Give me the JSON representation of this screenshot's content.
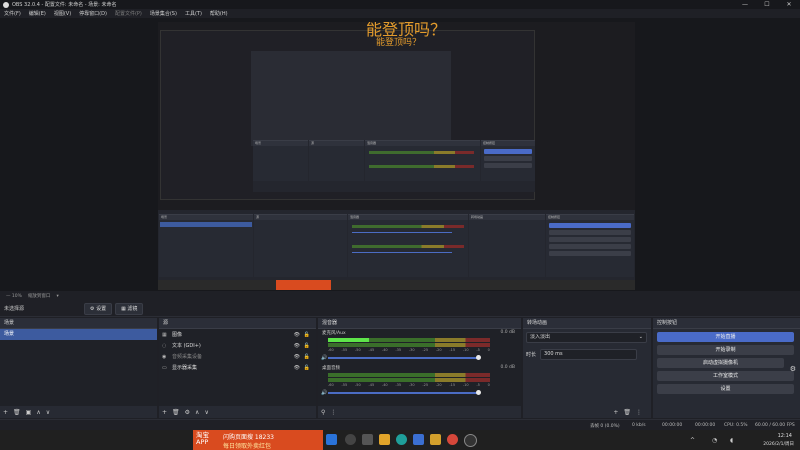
{
  "window": {
    "title": "OBS 32.0.4 - 配置文件: 未命名 - 场景: 未命名",
    "controls": [
      "—",
      "☐",
      "✕"
    ]
  },
  "menu": [
    "文件(F)",
    "编辑(E)",
    "视图(V)",
    "停靠窗口(D)",
    "配置文件(P)",
    "场景集合(S)",
    "工具(T)",
    "帮助(H)"
  ],
  "preview": {
    "overlay_text_1": "能登顶吗？",
    "overlay_text_2": "能登顶吗？",
    "zoom_label": "—  10%",
    "zoom_mode": "缩放到窗口",
    "zoom_arrow": "▾"
  },
  "scene_toolbar": {
    "label": "未选择源",
    "settings_label": "⚙ 设置",
    "filters_label": "▦ 滤镜"
  },
  "scenes": {
    "title": "场景",
    "items": [
      "场景"
    ],
    "footer_icons": [
      "+",
      "🗑",
      "▣",
      "∧",
      "∨"
    ]
  },
  "sources": {
    "title": "源",
    "items": [
      {
        "icon": "▦",
        "label": "图像",
        "visible": true,
        "locked": false
      },
      {
        "icon": "◌",
        "label": "文本 (GDI+)",
        "visible": true,
        "locked": false
      },
      {
        "icon": "◉",
        "label": "音频采集设备",
        "visible": true,
        "locked": false,
        "disabled": true
      },
      {
        "icon": "▭",
        "label": "显示器采集",
        "visible": true,
        "locked": false
      }
    ],
    "footer_icons": [
      "+",
      "🗑",
      "⚙",
      "∧",
      "∨"
    ]
  },
  "mixer": {
    "title": "混音器",
    "channels": [
      {
        "name": "麦克风/Aux",
        "db": "0.0 dB",
        "level": 0.25
      },
      {
        "name": "桌面音频",
        "db": "0.0 dB",
        "level": 0.0
      }
    ],
    "ticks": [
      "-60",
      "-55",
      "-50",
      "-45",
      "-40",
      "-35",
      "-30",
      "-25",
      "-20",
      "-15",
      "-10",
      "-5",
      "0"
    ],
    "footer_icons": [
      "⚲",
      "⋮"
    ]
  },
  "transitions": {
    "title": "转场动画",
    "transition": "淡入淡出",
    "duration_label": "时长",
    "duration": "300 ms",
    "footer_icons": [
      "+",
      "🗑",
      "⋮"
    ]
  },
  "controls": {
    "title": "控制按钮",
    "buttons": [
      "开始直播",
      "开始录制",
      "启动虚拟摄像机",
      "工作室模式",
      "设置"
    ]
  },
  "status": {
    "frames": "丢帧 0 (0.0%)",
    "kbps": "0 kb/s",
    "live_time": "00:00:00",
    "rec_time": "00:00:00",
    "cpu": "CPU: 0.5%",
    "fps": "60.00 / 60.00 FPS"
  },
  "taskbar": {
    "ad_brand": "淘宝APP",
    "ad_line1": "闪购页面搜 18233",
    "ad_line2": "每日领取外卖红包",
    "clock_time": "12:14",
    "clock_date": "2026/2/1/周日"
  },
  "colors": {
    "accent": "#4a6bc8",
    "overlay": "#e39b2c",
    "meter_green": "#5ee54a"
  }
}
